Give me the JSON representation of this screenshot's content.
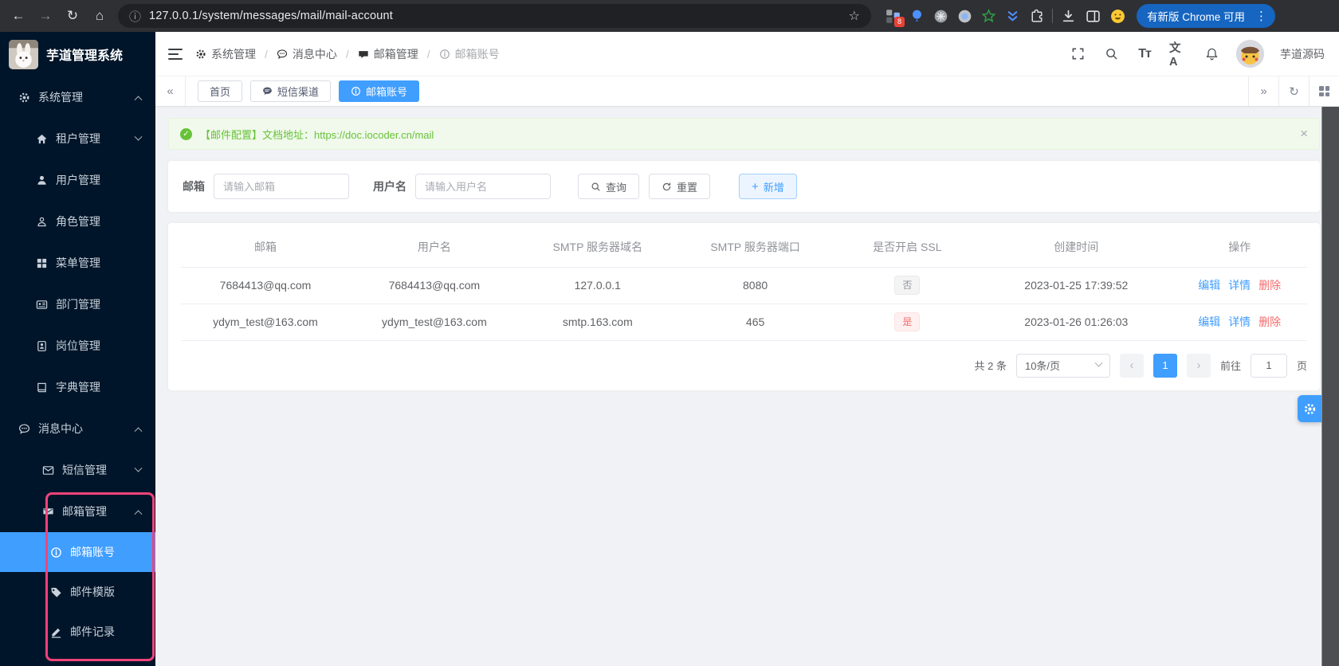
{
  "icons": {
    "back": "←",
    "forward": "→",
    "reload": "↻",
    "home": "⌂",
    "info": "ⓘ",
    "star": "☆",
    "dots": "⋮",
    "close": "×",
    "tab_prev": "«",
    "tab_next": "»",
    "tab_refresh": "↻",
    "pager_prev": "‹",
    "pager_next": "›",
    "plus": "+",
    "check": "✓",
    "font_size": "Tт",
    "language": "文A"
  },
  "browser": {
    "url": "127.0.0.1/system/messages/mail/mail-account",
    "update_label": "有新版 Chrome 可用",
    "extension_badge": "8"
  },
  "app": {
    "title": "芋道管理系统",
    "username": "芋道源码"
  },
  "breadcrumb": {
    "separator": "/",
    "items": [
      {
        "label": "系统管理"
      },
      {
        "label": "消息中心"
      },
      {
        "label": "邮箱管理"
      },
      {
        "label": "邮箱账号"
      }
    ]
  },
  "tabs": {
    "items": [
      {
        "label": "首页"
      },
      {
        "label": "短信渠道"
      },
      {
        "label": "邮箱账号"
      }
    ]
  },
  "sidebar": {
    "items": [
      {
        "label": "系统管理"
      },
      {
        "label": "租户管理"
      },
      {
        "label": "用户管理"
      },
      {
        "label": "角色管理"
      },
      {
        "label": "菜单管理"
      },
      {
        "label": "部门管理"
      },
      {
        "label": "岗位管理"
      },
      {
        "label": "字典管理"
      },
      {
        "label": "消息中心"
      },
      {
        "label": "短信管理"
      },
      {
        "label": "邮箱管理"
      },
      {
        "label": "邮箱账号"
      },
      {
        "label": "邮件模版"
      },
      {
        "label": "邮件记录"
      }
    ]
  },
  "alert": {
    "message": "【邮件配置】文档地址：",
    "link": "https://doc.iocoder.cn/mail"
  },
  "search": {
    "email_label": "邮箱",
    "email_placeholder": "请输入邮箱",
    "username_label": "用户名",
    "username_placeholder": "请输入用户名",
    "query_label": "查询",
    "reset_label": "重置",
    "add_label": "新增"
  },
  "table": {
    "headers": [
      "邮箱",
      "用户名",
      "SMTP 服务器域名",
      "SMTP 服务器端口",
      "是否开启 SSL",
      "创建时间",
      "操作"
    ],
    "rows": [
      {
        "email": "7684413@qq.com",
        "username": "7684413@qq.com",
        "domain": "127.0.0.1",
        "port": "8080",
        "ssl": "否",
        "created": "2023-01-25 17:39:52"
      },
      {
        "email": "ydym_test@163.com",
        "username": "ydym_test@163.com",
        "domain": "smtp.163.com",
        "port": "465",
        "ssl": "是",
        "created": "2023-01-26 01:26:03"
      }
    ],
    "actions": {
      "edit": "编辑",
      "detail": "详情",
      "remove": "删除"
    }
  },
  "pagination": {
    "total": "共 2 条",
    "page_size": "10条/页",
    "current_page": "1",
    "goto_label": "前往",
    "goto_value": "1",
    "page_unit": "页"
  },
  "colors": {
    "primary": "#409eff",
    "success": "#67c23a",
    "danger": "#f56c6c",
    "sidebar_bg": "#001529",
    "annotation": "#f0437b"
  }
}
